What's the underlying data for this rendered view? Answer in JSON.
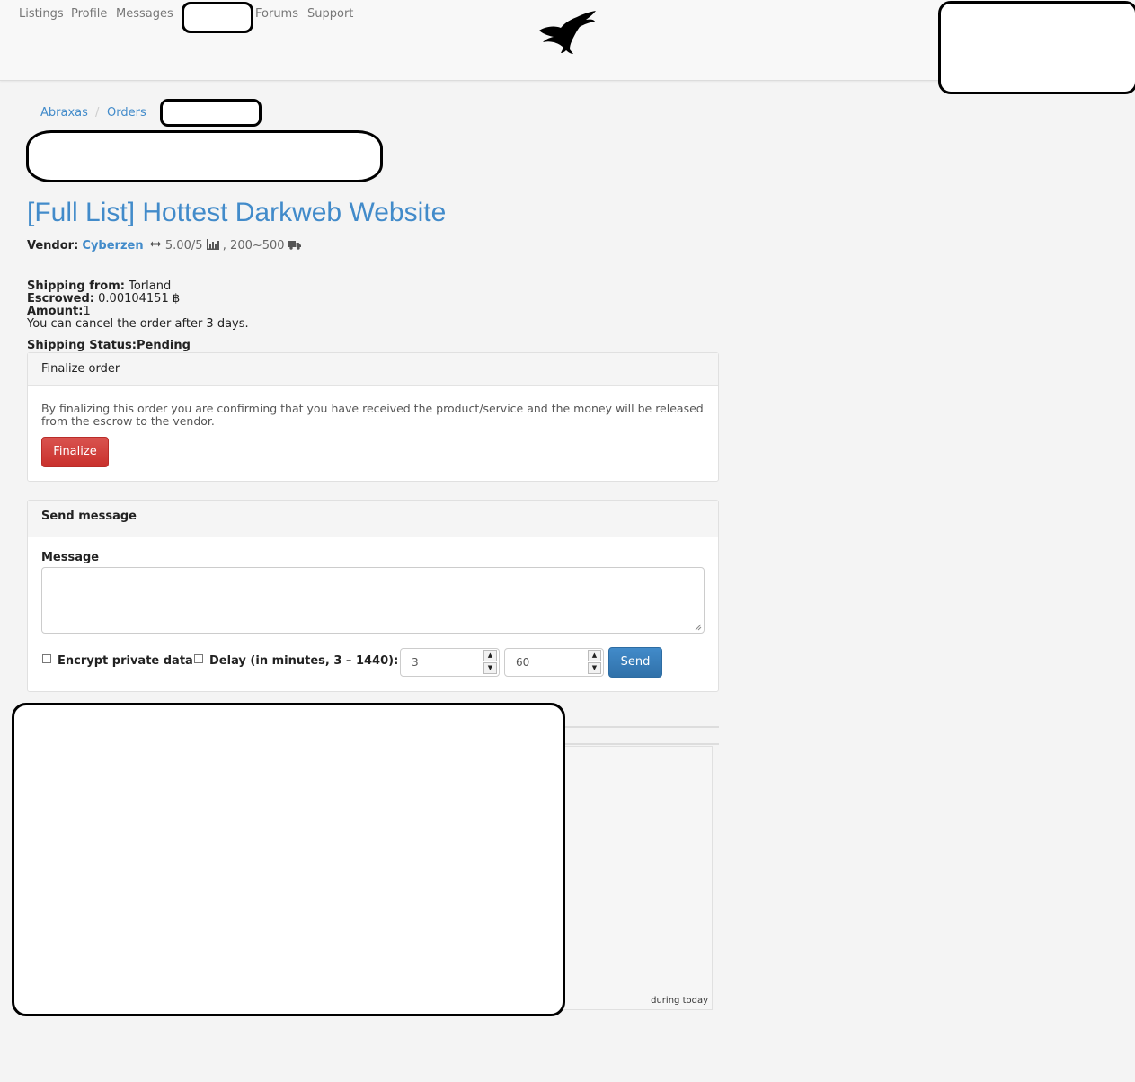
{
  "nav": {
    "items": [
      "Listings",
      "Profile",
      "Messages",
      "Forums",
      "Support"
    ]
  },
  "breadcrumb": {
    "items": [
      "Abraxas",
      "Orders"
    ],
    "separator": "/"
  },
  "listing": {
    "title": "[Full List] Hottest Darkweb Website",
    "vendor_label": "Vendor:",
    "vendor_name": "Cyberzen",
    "rating": "5.00/5",
    "sales_range": ", 200~500"
  },
  "order": {
    "shipping_from_label": "Shipping from:",
    "shipping_from": "Torland",
    "escrowed_label": "Escrowed:",
    "escrowed": "0.00104151 ฿",
    "amount_label": "Amount:",
    "amount": "1",
    "cancel_note": "You can cancel the order after 3 days.",
    "shipping_status_label": "Shipping Status:",
    "shipping_status": "Pending"
  },
  "finalize_panel": {
    "title": "Finalize order",
    "text": "By finalizing this order you are confirming that you have received the product/service and the money will be released from the escrow to the vendor.",
    "button": "Finalize"
  },
  "message_panel": {
    "title": "Send message",
    "message_label": "Message",
    "encrypt_label": "Encrypt private data",
    "delay_label": "Delay (in minutes, 3 – 1440):",
    "delay_min": "3",
    "delay_max": "60",
    "send_button": "Send"
  },
  "graph": {
    "caption": "during today"
  },
  "colors": {
    "link": "#428bca",
    "danger": "#d9534f",
    "primary": "#428bca",
    "page_bg": "#f4f4f4"
  }
}
